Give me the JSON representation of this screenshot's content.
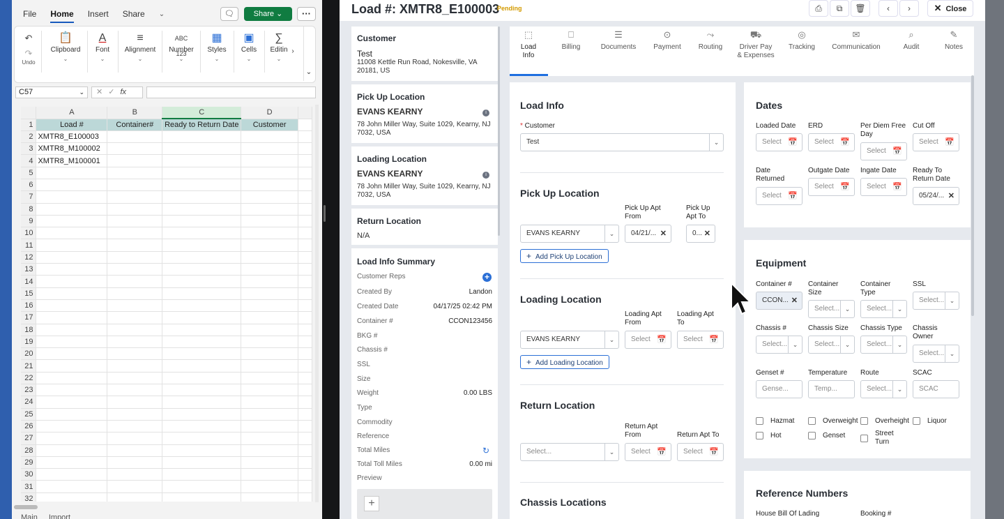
{
  "excel": {
    "menu": [
      "File",
      "Home",
      "Insert",
      "Share"
    ],
    "share_button": "Share",
    "ribbon": {
      "undo": "Undo",
      "groups": [
        "Clipboard",
        "Font",
        "Alignment",
        "Number",
        "Styles",
        "Cells",
        "Editin"
      ]
    },
    "name_box": "C57",
    "fx_label": "fx",
    "columns": [
      "A",
      "B",
      "C",
      "D"
    ],
    "selected_column": "C",
    "header_row": [
      "Load #",
      "Container#",
      "Ready to Return Date",
      "Customer"
    ],
    "data_rows": [
      [
        "XMTR8_E100003",
        "",
        "",
        ""
      ],
      [
        "XMTR8_M100002",
        "",
        "",
        ""
      ],
      [
        "XMTR8_M100001",
        "",
        "",
        ""
      ]
    ],
    "row_count": 32,
    "sheet_tabs": [
      "Main",
      "Import"
    ]
  },
  "tms": {
    "load_title": "Load #: XMTR8_E100003",
    "status": "Pending",
    "close_label": "Close",
    "left": {
      "customer": {
        "label": "Customer",
        "name": "Test",
        "address": "11008 Kettle Run Road, Nokesville, VA 20181, US"
      },
      "pickup": {
        "label": "Pick Up Location",
        "name": "EVANS KEARNY",
        "address": "78 John Miller Way, Suite 1029, Kearny, NJ 7032, USA"
      },
      "loading": {
        "label": "Loading Location",
        "name": "EVANS KEARNY",
        "address": "78 John Miller Way, Suite 1029, Kearny, NJ 7032, USA"
      },
      "return": {
        "label": "Return Location",
        "value": "N/A"
      },
      "summary": {
        "label": "Load Info Summary",
        "customer_reps": "Customer Reps",
        "rows": [
          {
            "k": "Created By",
            "v": "Landon"
          },
          {
            "k": "Created Date",
            "v": "04/17/25 02:42 PM"
          },
          {
            "k": "Container #",
            "v": "CCON123456"
          },
          {
            "k": "BKG #",
            "v": ""
          },
          {
            "k": "Chassis #",
            "v": ""
          },
          {
            "k": "SSL",
            "v": ""
          },
          {
            "k": "Size",
            "v": ""
          },
          {
            "k": "Weight",
            "v": "0.00 LBS"
          },
          {
            "k": "Type",
            "v": ""
          },
          {
            "k": "Commodity",
            "v": ""
          },
          {
            "k": "Reference",
            "v": ""
          },
          {
            "k": "Total Miles",
            "v": ""
          },
          {
            "k": "Total Toll Miles",
            "v": "0.00 mi"
          },
          {
            "k": "Preview",
            "v": ""
          }
        ]
      }
    },
    "tabs": [
      {
        "label": "Load Info",
        "icon": "load-info-icon"
      },
      {
        "label": "Billing",
        "icon": "billing-icon"
      },
      {
        "label": "Documents",
        "icon": "documents-icon"
      },
      {
        "label": "Payment",
        "icon": "payment-icon"
      },
      {
        "label": "Routing",
        "icon": "routing-icon"
      },
      {
        "label": "Driver Pay & Expenses",
        "icon": "driver-pay-icon"
      },
      {
        "label": "Tracking",
        "icon": "tracking-icon"
      },
      {
        "label": "Communication",
        "icon": "communication-icon"
      },
      {
        "label": "Audit",
        "icon": "audit-icon"
      },
      {
        "label": "Notes",
        "icon": "notes-icon"
      }
    ],
    "load_info": {
      "title": "Load Info",
      "customer_label": "Customer",
      "customer_value": "Test",
      "pickup": {
        "title": "Pick Up Location",
        "location": "EVANS KEARNY",
        "apt_from_label": "Pick Up Apt From",
        "apt_from_value": "04/21/...",
        "apt_to_label": "Pick Up Apt To",
        "apt_to_value": "0...",
        "add_button": "Add Pick Up Location"
      },
      "loading": {
        "title": "Loading Location",
        "location": "EVANS KEARNY",
        "apt_from_label": "Loading Apt From",
        "apt_to_label": "Loading Apt To",
        "placeholder": "Select",
        "add_button": "Add Loading Location"
      },
      "return": {
        "title": "Return Location",
        "location_placeholder": "Select...",
        "apt_from_label": "Return Apt From",
        "apt_to_label": "Return Apt To",
        "placeholder": "Select"
      },
      "chassis_title": "Chassis Locations"
    },
    "dates": {
      "title": "Dates",
      "loaded_date": "Loaded Date",
      "erd": "ERD",
      "per_diem": "Per Diem Free Day",
      "cut_off": "Cut Off",
      "date_returned": "Date Returned",
      "outgate": "Outgate Date",
      "ingate": "Ingate Date",
      "ready_return": "Ready To Return Date",
      "ready_return_value": "05/24/...",
      "placeholder": "Select"
    },
    "equipment": {
      "title": "Equipment",
      "container_no": "Container #",
      "container_no_value": "CCON...",
      "container_size": "Container Size",
      "container_type": "Container Type",
      "ssl": "SSL",
      "chassis_no": "Chassis #",
      "chassis_size": "Chassis Size",
      "chassis_type": "Chassis Type",
      "chassis_owner": "Chassis Owner",
      "genset_no": "Genset #",
      "genset_ph": "Gense...",
      "temperature": "Temperature",
      "temperature_ph": "Temp...",
      "route": "Route",
      "scac": "SCAC",
      "select_ph": "Select...",
      "checks": [
        "Hazmat",
        "Overweight",
        "Overheight",
        "Liquor",
        "Hot",
        "Genset",
        "Street Turn"
      ]
    },
    "reference": {
      "title": "Reference Numbers",
      "house_bol": "House Bill Of Lading",
      "booking": "Booking #"
    }
  }
}
